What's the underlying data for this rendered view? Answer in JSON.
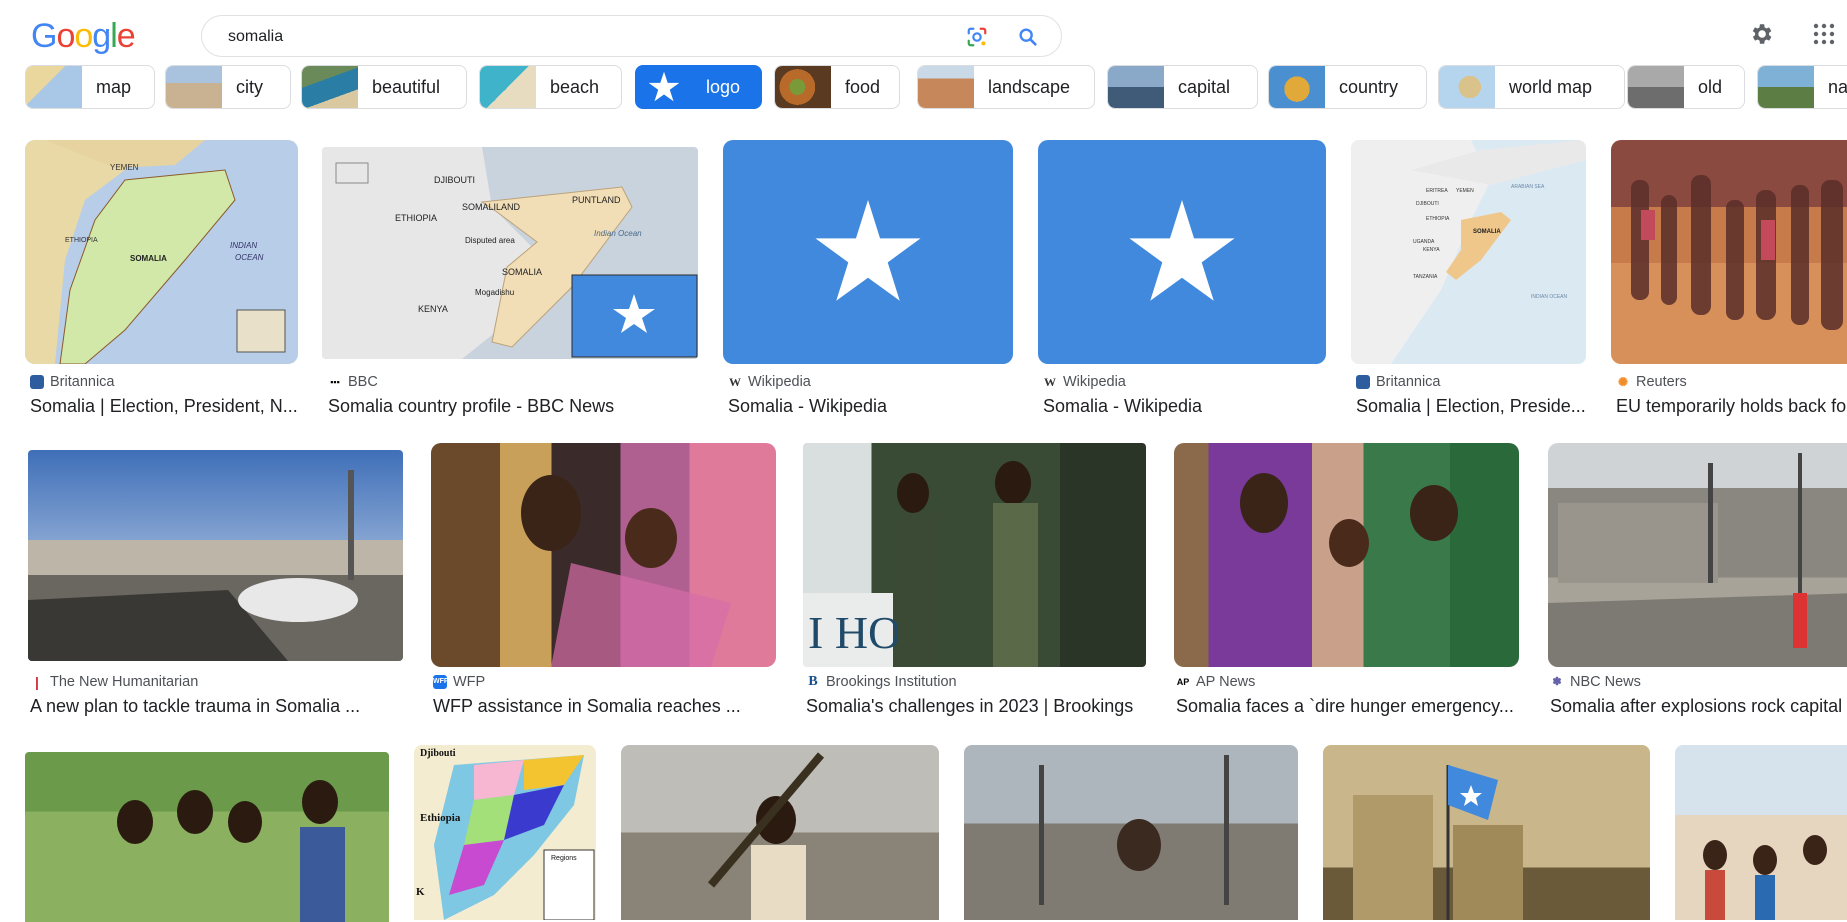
{
  "logo": {
    "letters": [
      "G",
      "o",
      "o",
      "g",
      "l",
      "e"
    ],
    "colors": [
      "#4285f4",
      "#ea4335",
      "#fbbc05",
      "#4285f4",
      "#34a853",
      "#ea4335"
    ]
  },
  "search": {
    "query": "somalia"
  },
  "icons": {
    "lens": "google-lens-icon",
    "search": "search-icon",
    "settings": "gear-icon",
    "apps": "apps-grid-icon"
  },
  "chips": [
    {
      "label": "map"
    },
    {
      "label": "city"
    },
    {
      "label": "beautiful"
    },
    {
      "label": "beach"
    },
    {
      "label": "logo",
      "selected": true
    },
    {
      "label": "food"
    },
    {
      "label": "landscape"
    },
    {
      "label": "capital"
    },
    {
      "label": "country"
    },
    {
      "label": "world map"
    },
    {
      "label": "old"
    },
    {
      "label": "na"
    }
  ],
  "map_labels": {
    "britannica": {
      "yemen": "YEMEN",
      "ethiopia": "ETHIOPIA",
      "somalia": "SOMALIA",
      "indian": "INDIAN",
      "ocean": "OCEAN"
    },
    "bbc": {
      "djibouti": "DJIBOUTI",
      "somaliland": "SOMALILAND",
      "puntland": "PUNTLAND",
      "ethiopia": "ETHIOPIA",
      "disputed": "Disputed area",
      "somalia": "SOMALIA",
      "mogadishu": "Mogadishu",
      "kenya": "KENYA",
      "ocean": "Indian Ocean"
    },
    "britannica2": {
      "eritrea": "ERITREA",
      "yemen": "YEMEN",
      "djibouti": "DJIBOUTI",
      "ethiopia": "ETHIOPIA",
      "somalia": "SOMALIA",
      "uganda": "UGANDA",
      "kenya": "KENYA",
      "tanzania": "TANZANIA",
      "arabian": "ARABIAN SEA",
      "indian": "INDIAN OCEAN"
    },
    "regions": {
      "djibouti": "Djibouti",
      "ethiopia": "Ethiopia",
      "regions": "Regions",
      "k": "K"
    },
    "hotel_sign": "I HOT"
  },
  "row1": [
    {
      "source": "Britannica",
      "title": "Somalia | Election, President, N..."
    },
    {
      "source": "BBC",
      "title": "Somalia country profile - BBC News"
    },
    {
      "source": "Wikipedia",
      "title": "Somalia - Wikipedia"
    },
    {
      "source": "Wikipedia",
      "title": "Somalia - Wikipedia"
    },
    {
      "source": "Britannica",
      "title": "Somalia | Election, Preside..."
    },
    {
      "source": "Reuters",
      "title": "EU temporarily holds back fo"
    }
  ],
  "row2": [
    {
      "source": "The New Humanitarian",
      "title": "A new plan to tackle trauma in Somalia ..."
    },
    {
      "source": "WFP",
      "title": "WFP assistance in Somalia reaches ..."
    },
    {
      "source": "Brookings Institution",
      "title": "Somalia's challenges in 2023 | Brookings"
    },
    {
      "source": "AP News",
      "title": "Somalia faces a `dire hunger emergency..."
    },
    {
      "source": "NBC News",
      "title": "Somalia after explosions rock capital"
    }
  ],
  "colors": {
    "flag_blue": "#4189dd",
    "accent": "#1a73e8"
  }
}
